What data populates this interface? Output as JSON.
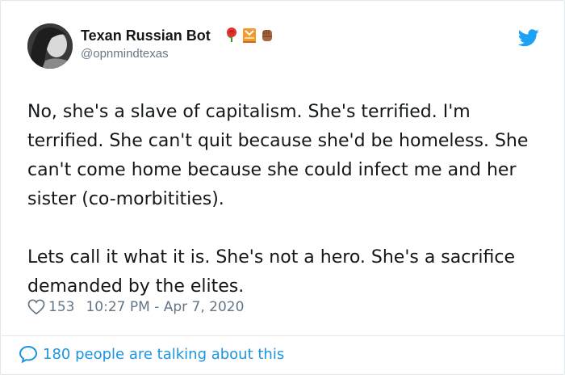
{
  "author": {
    "display_name": "Texan Russian Bot",
    "handle": "@opnmindtexas",
    "name_emojis": [
      "rose-emoji",
      "construction-worker-emoji",
      "raised-fist-emoji"
    ]
  },
  "tweet": {
    "paragraphs": [
      "No, she's a slave of capitalism. She's terrified. I'm terrified. She can't quit because she'd be homeless. She can't come home because she could infect me and her sister (co-morbitities).",
      "Lets call it what it is. She's not a hero. She's a sacrifice demanded by the elites."
    ],
    "likes": "153",
    "timestamp": "10:27 PM - Apr 7, 2020"
  },
  "footer": {
    "talking_label": "180 people are talking about this"
  },
  "colors": {
    "accent": "#1b95e0",
    "muted": "#657786",
    "text": "#14171a",
    "border": "#e1e8ed"
  }
}
